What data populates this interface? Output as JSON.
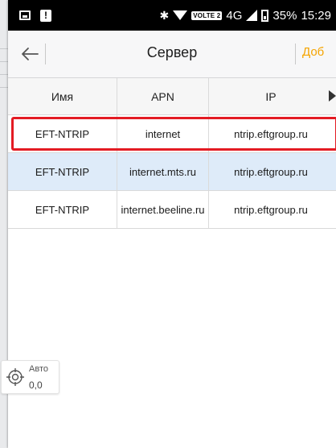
{
  "status_bar": {
    "volte": "VOLTE 2",
    "network": "4G",
    "battery": "35%",
    "time": "15:29"
  },
  "app_bar": {
    "title": "Сервер",
    "add_label": "Доб"
  },
  "table": {
    "columns": [
      "Имя",
      "APN",
      "IP"
    ],
    "rows": [
      [
        "EFT-NTRIP",
        "internet",
        "ntrip.eftgroup.ru"
      ],
      [
        "EFT-NTRIP",
        "internet.mts.ru",
        "ntrip.eftgroup.ru"
      ],
      [
        "EFT-NTRIP",
        "internet.beeline.ru",
        "ntrip.eftgroup.ru"
      ]
    ]
  },
  "auto_button": {
    "label": "Авто",
    "value": "0,0"
  },
  "colors": {
    "accent": "#f5a400",
    "highlight": "#e31b23",
    "selected_row": "#deebf9"
  }
}
